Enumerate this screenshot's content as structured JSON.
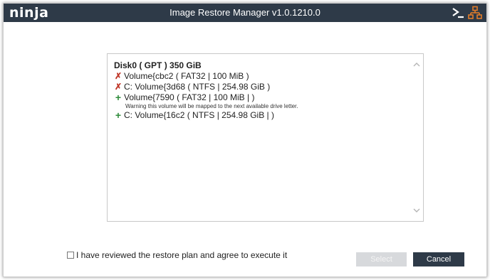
{
  "titlebar": {
    "logo": "ninja",
    "title": "Image Restore Manager v1.0.1210.0",
    "terminal_icon": "terminal-icon",
    "network_icon": "network-icon"
  },
  "disk": {
    "title": "Disk0 ( GPT ) 350 GiB",
    "volumes": [
      {
        "mark": "✗",
        "type": "remove",
        "label": "Volume{cbc2 ( FAT32 | 100 MiB )"
      },
      {
        "mark": "✗",
        "type": "remove",
        "label": "C: Volume{3d68 ( NTFS | 254.98 GiB )"
      },
      {
        "mark": "+",
        "type": "add",
        "label": "Volume{7590 ( FAT32 | 100 MiB | )"
      },
      {
        "mark": "+",
        "type": "add",
        "label": "C: Volume{16c2 ( NTFS | 254.98 GiB | )"
      }
    ],
    "warning": "Warning this volume will be mapped to the next available drive letter."
  },
  "agreement": {
    "label": "I have reviewed the restore plan and agree to execute it",
    "checked": false
  },
  "buttons": {
    "select": "Select",
    "cancel": "Cancel"
  },
  "colors": {
    "titlebar": "#2e3a48",
    "remove": "#c0392b",
    "add": "#2e8b3a",
    "accent_icon": "#e07b2a"
  }
}
